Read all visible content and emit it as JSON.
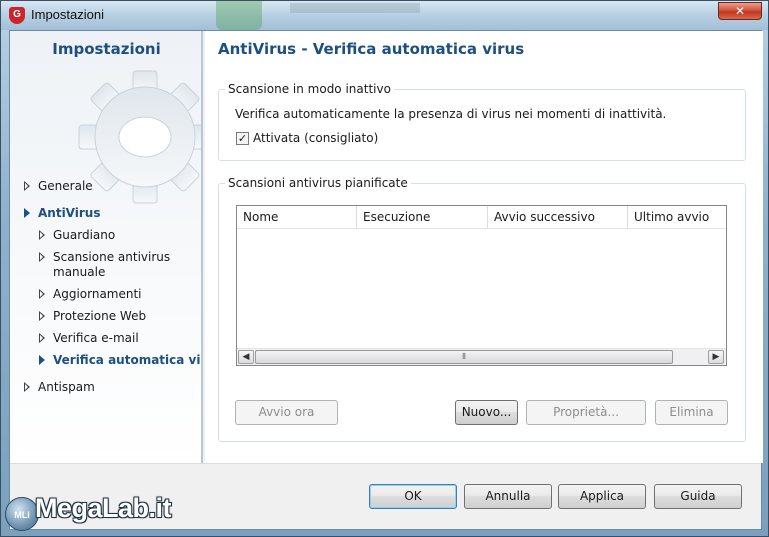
{
  "window": {
    "title": "Impostazioni",
    "close_glyph": "✕",
    "app_icon": "shield-icon",
    "app_icon_letter": "G"
  },
  "sidebar": {
    "title": "Impostazioni",
    "decor_icon": "gear-icon",
    "items": [
      {
        "label": "Generale",
        "level": 0,
        "state": "collapsed"
      },
      {
        "label": "AntiVirus",
        "level": 0,
        "state": "expanded",
        "active": true
      },
      {
        "label": "Guardiano",
        "level": 1,
        "state": "collapsed"
      },
      {
        "label": "Scansione antivirus manuale",
        "level": 1,
        "state": "collapsed"
      },
      {
        "label": "Aggiornamenti",
        "level": 1,
        "state": "collapsed"
      },
      {
        "label": "Protezione Web",
        "level": 1,
        "state": "collapsed"
      },
      {
        "label": "Verifica e-mail",
        "level": 1,
        "state": "collapsed"
      },
      {
        "label": "Verifica automatica virus",
        "level": 1,
        "state": "selected",
        "active": true
      },
      {
        "label": "Antispam",
        "level": 0,
        "state": "collapsed"
      }
    ]
  },
  "main": {
    "title": "AntiVirus - Verifica automatica virus",
    "idle_scan": {
      "legend": "Scansione in modo inattivo",
      "description": "Verifica automaticamente la presenza di virus nei momenti di inattività.",
      "checkbox_label": "Attivata (consigliato)",
      "checkbox_checked": true
    },
    "scheduled": {
      "legend": "Scansioni antivirus pianificate",
      "columns": [
        "Nome",
        "Esecuzione",
        "Avvio successivo",
        "Ultimo avvio"
      ],
      "rows": [],
      "buttons": {
        "run_now": "Avvio ora",
        "new": "Nuovo...",
        "properties": "Proprietà...",
        "delete": "Elimina"
      }
    }
  },
  "footer": {
    "ok": "OK",
    "cancel": "Annulla",
    "apply": "Applica",
    "help": "Guida"
  },
  "watermark": {
    "text": "MegaLab.it",
    "badge": "MLI"
  }
}
